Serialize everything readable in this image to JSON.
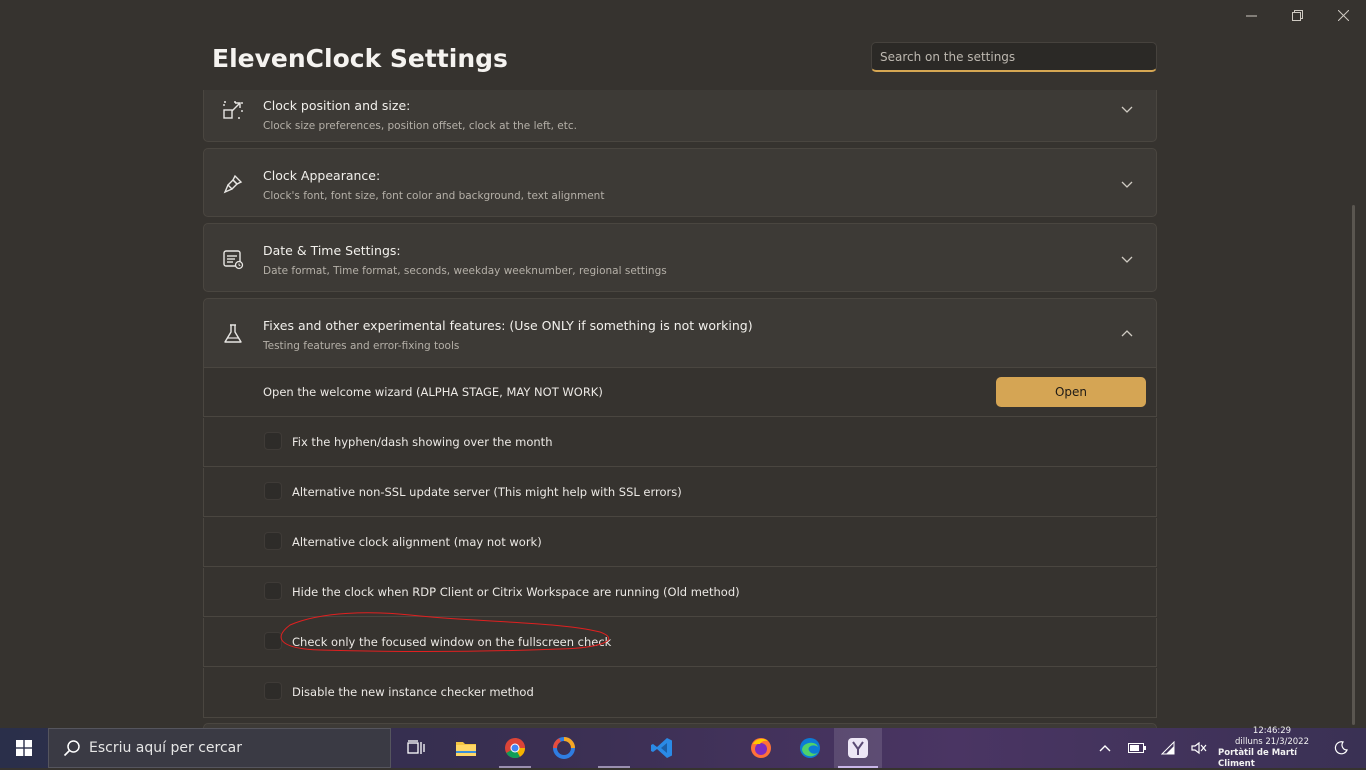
{
  "window": {
    "title": "ElevenClock Settings",
    "search_placeholder": "Search on the settings"
  },
  "sections": [
    {
      "title": "Clock position and size:",
      "subtitle": "Clock size preferences, position offset, clock at the left, etc.",
      "icon": "resize-icon",
      "expanded": false
    },
    {
      "title": "Clock Appearance:",
      "subtitle": "Clock's font, font size, font color and background, text alignment",
      "icon": "paintbrush-icon",
      "expanded": false
    },
    {
      "title": "Date & Time Settings:",
      "subtitle": "Date format, Time format, seconds, weekday weeknumber, regional settings",
      "icon": "calendar-list-icon",
      "expanded": false
    },
    {
      "title": "Fixes and other experimental features: (Use ONLY if something is not working)",
      "subtitle": "Testing features and error-fixing tools",
      "icon": "flask-icon",
      "expanded": true
    }
  ],
  "experimental": {
    "wizard_label": "Open the welcome wizard (ALPHA STAGE, MAY NOT WORK)",
    "open_button": "Open",
    "options": [
      {
        "label": "Fix the hyphen/dash showing over the month",
        "checked": false
      },
      {
        "label": "Alternative non-SSL update server (This might help with SSL errors)",
        "checked": false
      },
      {
        "label": "Alternative clock alignment (may not work)",
        "checked": false
      },
      {
        "label": "Hide the clock when RDP Client or Citrix Workspace are running (Old method)",
        "checked": false
      },
      {
        "label": "Check only the focused window on the fullscreen check",
        "checked": false,
        "annotated": true
      },
      {
        "label": "Disable the new instance checker method",
        "checked": false
      }
    ]
  },
  "taskbar": {
    "search_placeholder": "Escriu aquí per cercar",
    "apps": [
      "task-view-icon",
      "file-explorer-icon",
      "chrome-icon",
      "app-ring-icon",
      "blank-app",
      "vscode-icon",
      "blank-app",
      "firefox-icon",
      "edge-icon",
      "elevenclock-icon"
    ],
    "clock": {
      "time": "12:46:29",
      "date": "dilluns 21/3/2022",
      "label": "Portàtil de Martí Climent"
    }
  },
  "colors": {
    "accent": "#d5a554",
    "background": "#36332f",
    "card": "#3d3a36",
    "annotation": "#e02020"
  }
}
